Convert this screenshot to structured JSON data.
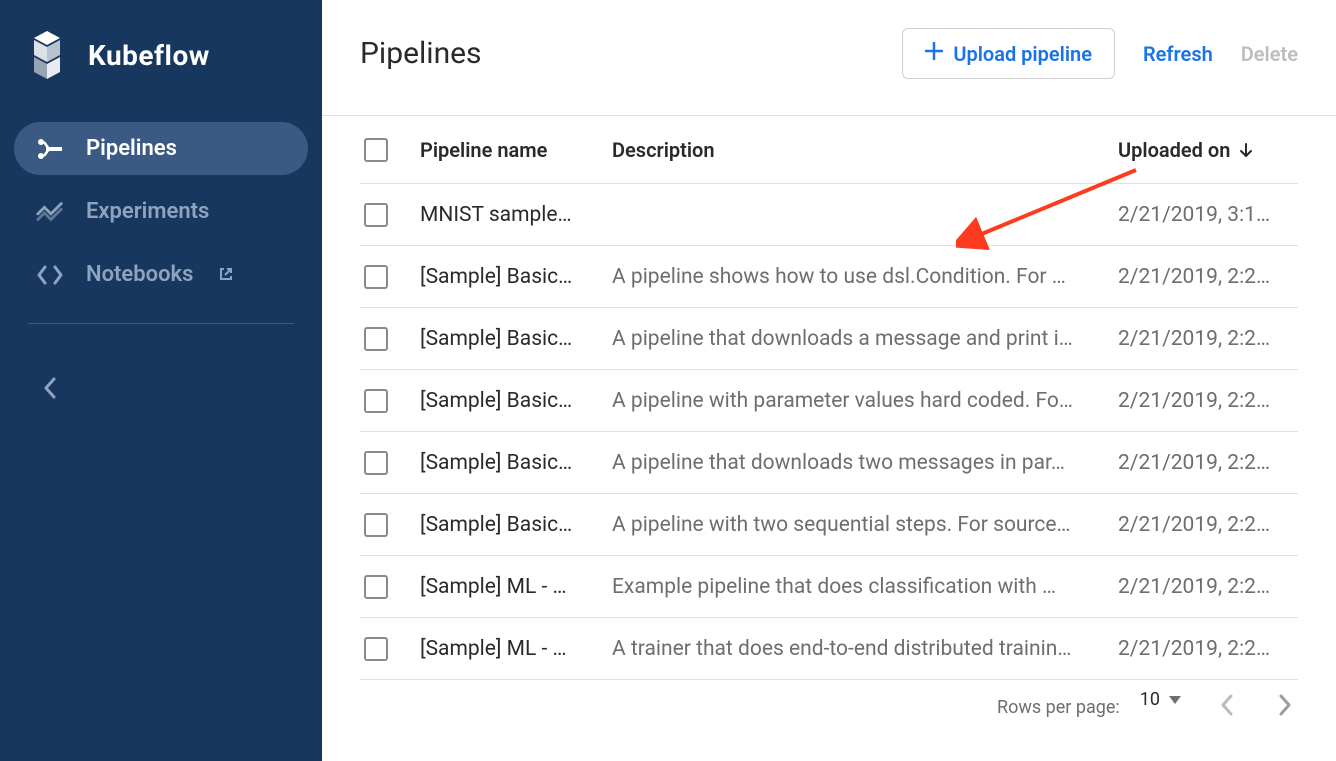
{
  "brand": {
    "name": "Kubeflow"
  },
  "sidebar": {
    "items": [
      {
        "label": "Pipelines",
        "active": true,
        "icon": "pipelines-icon"
      },
      {
        "label": "Experiments",
        "active": false,
        "icon": "experiments-icon"
      },
      {
        "label": "Notebooks",
        "active": false,
        "icon": "notebooks-icon",
        "external": true
      }
    ]
  },
  "page": {
    "title": "Pipelines"
  },
  "actions": {
    "upload": "Upload pipeline",
    "refresh": "Refresh",
    "delete": "Delete"
  },
  "table": {
    "headers": {
      "name": "Pipeline name",
      "description": "Description",
      "uploaded": "Uploaded on"
    },
    "rows": [
      {
        "name": "MNIST sample…",
        "description": "",
        "uploaded": "2/21/2019, 3:1…"
      },
      {
        "name": "[Sample] Basic…",
        "description": "A pipeline shows how to use dsl.Condition. For …",
        "uploaded": "2/21/2019, 2:2…"
      },
      {
        "name": "[Sample] Basic…",
        "description": "A pipeline that downloads a message and print i…",
        "uploaded": "2/21/2019, 2:2…"
      },
      {
        "name": "[Sample] Basic…",
        "description": "A pipeline with parameter values hard coded. Fo…",
        "uploaded": "2/21/2019, 2:2…"
      },
      {
        "name": "[Sample] Basic…",
        "description": "A pipeline that downloads two messages in par…",
        "uploaded": "2/21/2019, 2:2…"
      },
      {
        "name": "[Sample] Basic…",
        "description": "A pipeline with two sequential steps. For source…",
        "uploaded": "2/21/2019, 2:2…"
      },
      {
        "name": "[Sample] ML - …",
        "description": "Example pipeline that does classification with …",
        "uploaded": "2/21/2019, 2:2…"
      },
      {
        "name": "[Sample] ML - …",
        "description": "A trainer that does end-to-end distributed trainin…",
        "uploaded": "2/21/2019, 2:2…"
      }
    ]
  },
  "pagination": {
    "rows_label": "Rows per page:",
    "rows_value": "10"
  }
}
